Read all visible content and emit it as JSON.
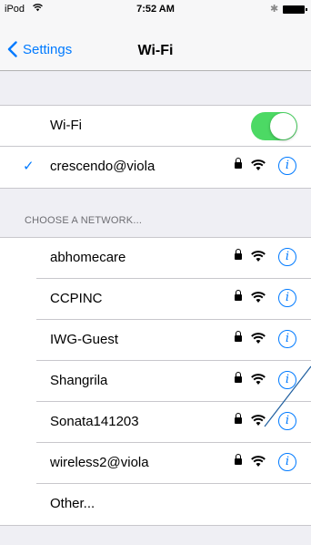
{
  "status_bar": {
    "carrier": "iPod",
    "time": "7:52 AM",
    "bluetooth": "✱"
  },
  "nav": {
    "back_label": "Settings",
    "title": "Wi-Fi"
  },
  "wifi_toggle": {
    "label": "Wi-Fi",
    "on": true
  },
  "connected": {
    "name": "crescendo@viola",
    "check": "✓"
  },
  "section_header": "CHOOSE A NETWORK...",
  "networks": [
    {
      "name": "abhomecare"
    },
    {
      "name": "CCPINC"
    },
    {
      "name": "IWG-Guest"
    },
    {
      "name": "Shangrila"
    },
    {
      "name": "Sonata141203"
    },
    {
      "name": "wireless2@viola"
    }
  ],
  "other_label": "Other...",
  "info_glyph": "i",
  "colors": {
    "accent": "#007aff",
    "toggle_on": "#4cd964",
    "annotation": "#1f5f9f"
  }
}
